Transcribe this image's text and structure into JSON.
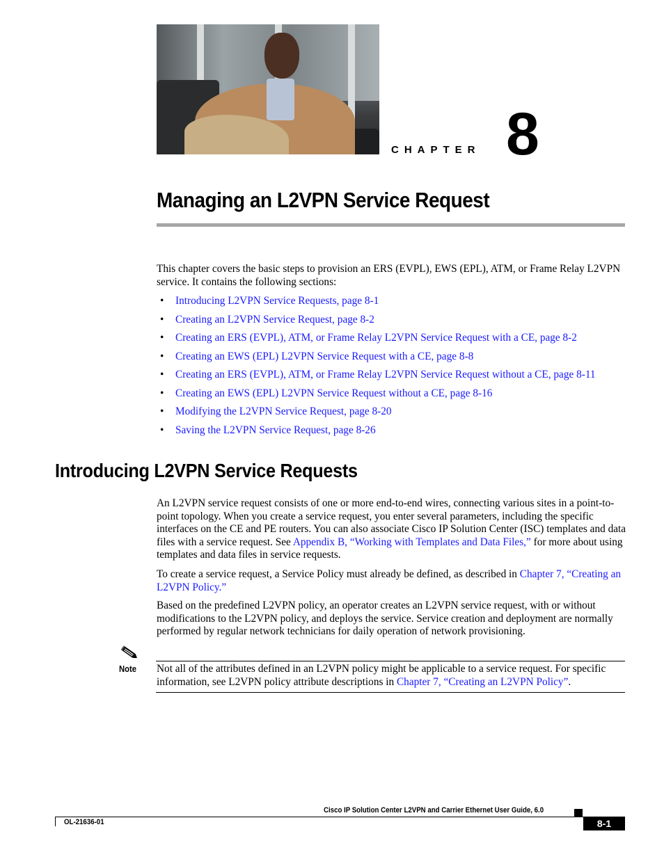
{
  "chapter": {
    "label": "CHAPTER",
    "number": "8",
    "title": "Managing an L2VPN Service Request",
    "photo_alt": "photo-of-seated-man"
  },
  "intro": {
    "text": "This chapter covers the basic steps to provision an ERS (EVPL), EWS (EPL), ATM, or Frame Relay L2VPN service. It contains the following sections:"
  },
  "toc": [
    {
      "label": "Introducing L2VPN Service Requests, page 8-1"
    },
    {
      "label": "Creating an L2VPN Service Request, page 8-2"
    },
    {
      "label": "Creating an ERS (EVPL), ATM, or Frame Relay L2VPN Service Request with a CE, page 8-2"
    },
    {
      "label": "Creating an EWS (EPL) L2VPN Service Request with a CE, page 8-8"
    },
    {
      "label": "Creating an ERS (EVPL), ATM, or Frame Relay L2VPN Service Request without a CE, page 8-11"
    },
    {
      "label": "Creating an EWS (EPL) L2VPN Service Request without a CE, page 8-16"
    },
    {
      "label": "Modifying the L2VPN Service Request, page 8-20"
    },
    {
      "label": "Saving the L2VPN Service Request, page 8-26"
    }
  ],
  "bullet": "•",
  "section": {
    "heading": "Introducing L2VPN Service Requests",
    "p1": {
      "text_before": "An L2VPN service request consists of one or more end-to-end wires, connecting various sites in a point-to-point topology. When you create a service request, you enter several parameters, including the specific interfaces on the CE and PE routers. You can also associate Cisco IP Solution Center (ISC) templates and data files with a service request. See ",
      "link": "Appendix B, “Working with Templates and Data Files,”",
      "text_after": " for more about using templates and data files in service requests."
    },
    "p2": {
      "text_before": "To create a service request, a Service Policy must already be defined, as described in ",
      "link": "Chapter 7, “Creating an L2VPN Policy.”",
      "text_after": ""
    },
    "p3": {
      "text": "Based on the predefined L2VPN policy, an operator creates an L2VPN service request, with or without modifications to the L2VPN policy, and deploys the service. Service creation and deployment are normally performed by regular network technicians for daily operation of network provisioning."
    }
  },
  "note": {
    "label": "Note",
    "text_before": "Not all of the attributes defined in an L2VPN policy might be applicable to a service request. For specific information, see L2VPN policy attribute descriptions in ",
    "link": "Chapter 7, “Creating an L2VPN Policy”",
    "text_after": "."
  },
  "footer": {
    "guide_title": "Cisco IP Solution Center L2VPN and Carrier Ethernet User Guide, 6.0",
    "doc_number": "OL-21636-01",
    "page_number": "8-1"
  },
  "colors": {
    "link": "#1a1aff",
    "rule": "#a6a6a6"
  }
}
